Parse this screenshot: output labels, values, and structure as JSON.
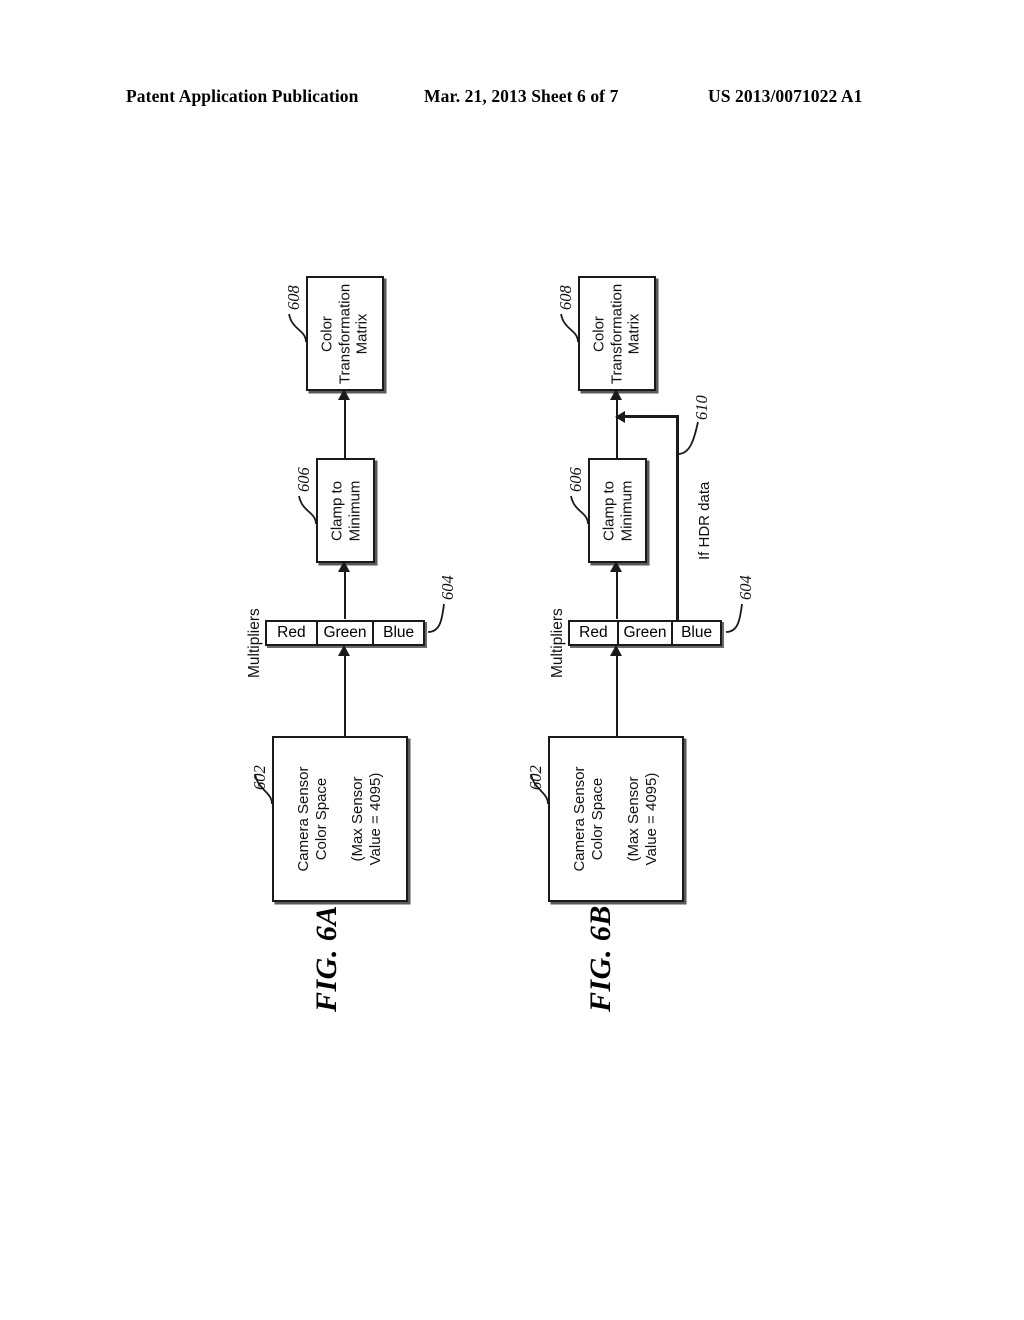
{
  "header": {
    "publication": "Patent Application Publication",
    "date_sheet": "Mar. 21, 2013  Sheet 6 of 7",
    "patent_number": "US 2013/0071022 A1"
  },
  "figures": [
    {
      "caption": "FIG. 6A",
      "blocks": [
        {
          "ref": "602",
          "name": "camera-sensor-color-space",
          "line1": "Camera Sensor",
          "line2": "Color Space",
          "line3": "(Max Sensor",
          "line4": "Value = 4095)"
        },
        {
          "ref": "606",
          "name": "clamp-to-minimum",
          "line1": "Clamp to",
          "line2": "Minimum"
        },
        {
          "ref": "608",
          "name": "color-transformation-matrix",
          "line1": "Color",
          "line2": "Transformation",
          "line3": "Matrix"
        }
      ],
      "multipliers": {
        "ref": "604",
        "caption": "Multipliers",
        "cells": [
          "Red",
          "Green",
          "Blue"
        ]
      }
    },
    {
      "caption": "FIG. 6B",
      "blocks": [
        {
          "ref": "602",
          "name": "camera-sensor-color-space",
          "line1": "Camera Sensor",
          "line2": "Color Space",
          "line3": "(Max Sensor",
          "line4": "Value = 4095)"
        },
        {
          "ref": "606",
          "name": "clamp-to-minimum",
          "line1": "Clamp to",
          "line2": "Minimum"
        },
        {
          "ref": "608",
          "name": "color-transformation-matrix",
          "line1": "Color",
          "line2": "Transformation",
          "line3": "Matrix"
        }
      ],
      "multipliers": {
        "ref": "604",
        "caption": "Multipliers",
        "cells": [
          "Red",
          "Green",
          "Blue"
        ]
      },
      "bypass": {
        "ref": "610",
        "label": "If HDR data"
      }
    }
  ]
}
